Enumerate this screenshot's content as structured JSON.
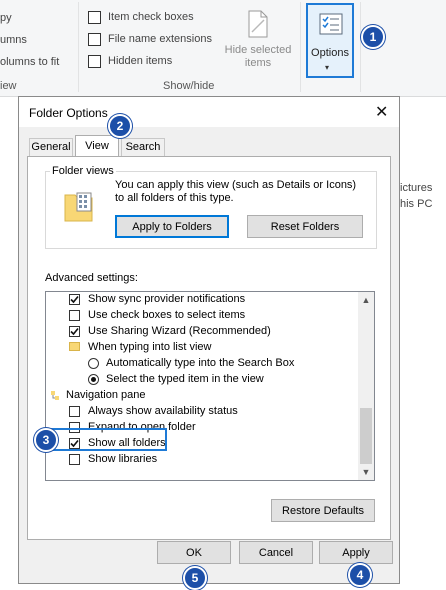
{
  "ribbon": {
    "layout_items": [
      "py",
      "umns",
      "olumns to fit"
    ],
    "show_hide": {
      "item_check_boxes": "Item check boxes",
      "file_name_extensions": "File name extensions",
      "hidden_items": "Hidden items",
      "hide_selected_items": "Hide selected\nitems",
      "group_label": "Show/hide"
    },
    "view_group_label": "iew",
    "options_label": "Options",
    "options_caret": "▾"
  },
  "background": {
    "right_text_1": "ictures",
    "right_text_2": "his PC"
  },
  "dialog": {
    "title": "Folder Options",
    "close": "✕",
    "tabs": [
      "General",
      "View",
      "Search"
    ],
    "folder_views": {
      "legend": "Folder views",
      "description": "You can apply this view (such as Details or Icons) to all folders of this type.",
      "apply_button": "Apply to Folders",
      "reset_button": "Reset Folders"
    },
    "advanced_label": "Advanced settings:",
    "advanced_items": [
      {
        "kind": "checkbox",
        "checked": true,
        "label": "Show sync provider notifications"
      },
      {
        "kind": "checkbox",
        "checked": false,
        "label": "Use check boxes to select items"
      },
      {
        "kind": "checkbox",
        "checked": true,
        "label": "Use Sharing Wizard (Recommended)"
      },
      {
        "kind": "folder",
        "checked": false,
        "label": "When typing into list view"
      },
      {
        "kind": "radio",
        "checked": false,
        "label": "Automatically type into the Search Box"
      },
      {
        "kind": "radio",
        "checked": true,
        "label": "Select the typed item in the view"
      },
      {
        "kind": "nav",
        "checked": false,
        "label": "Navigation pane"
      },
      {
        "kind": "checkbox",
        "checked": false,
        "label": "Always show availability status"
      },
      {
        "kind": "checkbox",
        "checked": false,
        "label": "Expand to open folder"
      },
      {
        "kind": "checkbox",
        "checked": true,
        "label": "Show all folders"
      },
      {
        "kind": "checkbox",
        "checked": false,
        "label": "Show libraries"
      }
    ],
    "restore_defaults": "Restore Defaults",
    "ok": "OK",
    "cancel": "Cancel",
    "apply": "Apply"
  },
  "callouts": [
    "1",
    "2",
    "3",
    "4",
    "5"
  ],
  "colors": {
    "accent": "#1e7ad6",
    "badge": "#1c4fa8",
    "dialog_bg": "#f0f0f0",
    "folder": "#f8d775"
  }
}
